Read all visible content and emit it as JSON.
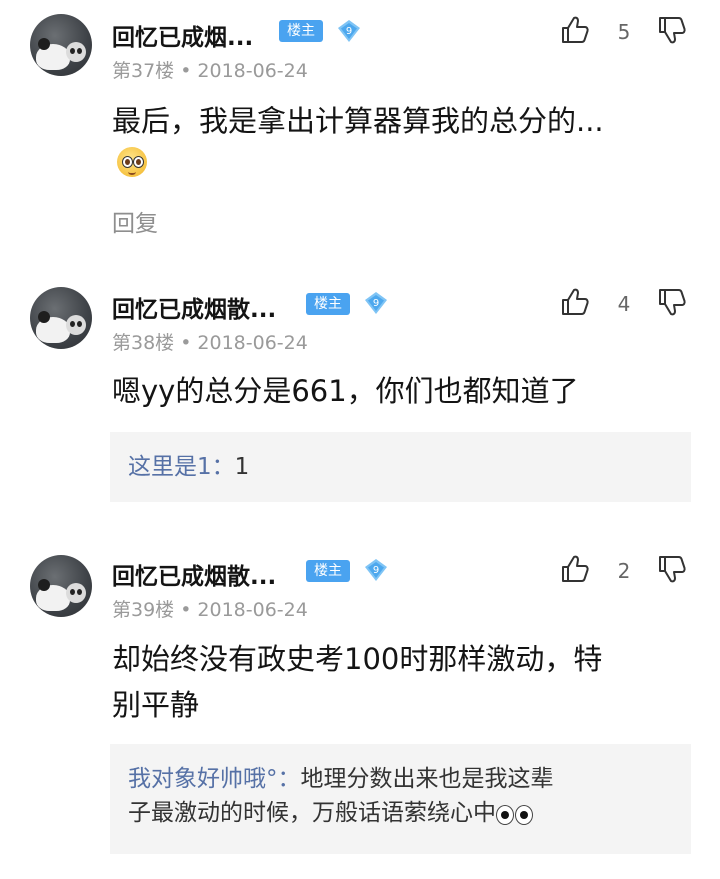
{
  "posts": [
    {
      "username": "回忆已成烟...",
      "owner_badge": "楼主",
      "level": "9",
      "floor": "第37楼",
      "date": "2018-06-24",
      "likes": "5",
      "content": "最后，我是拿出计算器算我的总分的...",
      "emoji": "astonished-face-emoji",
      "reply_label": "回复"
    },
    {
      "username": "回忆已成烟散...",
      "owner_badge": "楼主",
      "level": "9",
      "floor": "第38楼",
      "date": "2018-06-24",
      "likes": "4",
      "content": "嗯yy的总分是661，你们也都知道了",
      "quote": {
        "user": "这里是1",
        "separator": "：",
        "text": "1"
      }
    },
    {
      "username": "回忆已成烟散...",
      "owner_badge": "楼主",
      "level": "9",
      "floor": "第39楼",
      "date": "2018-06-24",
      "likes": "2",
      "content_line1": "却始终没有政史考100时那样激动，特",
      "content_line2": "别平静",
      "quote": {
        "user": "我对象好帅哦°",
        "separator": "：",
        "text_line1": "地理分数出来也是我这辈",
        "text_line2": "子最激动的时候，万般话语萦绕心中",
        "emoji": "eyes-emoji"
      }
    }
  ],
  "colors": {
    "owner_badge_bg": "#4aa3f0",
    "quote_user": "#5671a6",
    "meta_text": "#9a9a9a",
    "quote_bg": "#f4f4f4"
  },
  "icons": [
    "thumbs-up-icon",
    "thumbs-down-icon",
    "diamond-level-icon"
  ]
}
